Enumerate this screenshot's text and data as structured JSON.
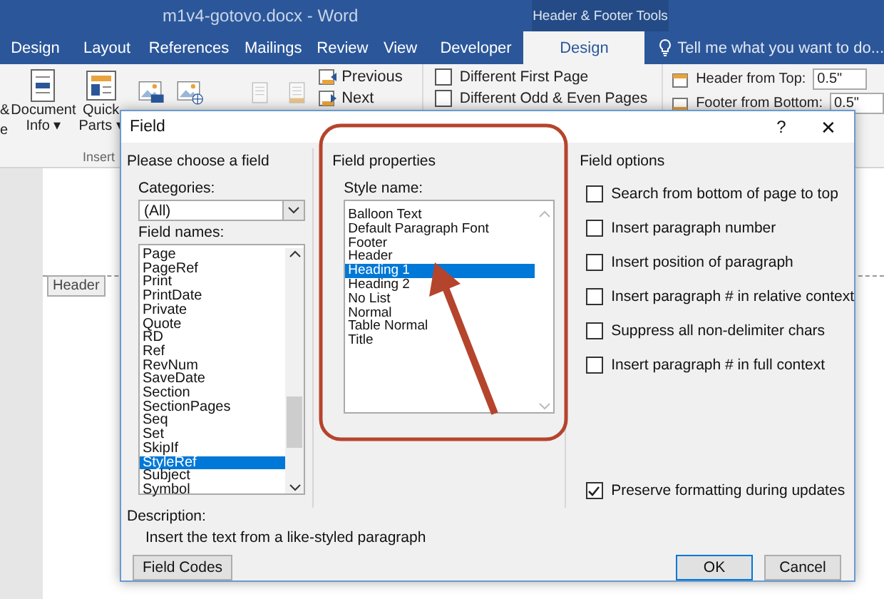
{
  "window": {
    "title": "m1v4-gotovo.docx - Word",
    "context_group": "Header & Footer Tools"
  },
  "ribbon_tabs": [
    {
      "label": "Design",
      "selected": false
    },
    {
      "label": "Layout",
      "selected": false
    },
    {
      "label": "References",
      "selected": false
    },
    {
      "label": "Mailings",
      "selected": false
    },
    {
      "label": "Review",
      "selected": false
    },
    {
      "label": "View",
      "selected": false
    },
    {
      "label": "Developer",
      "selected": false
    },
    {
      "label": "Design",
      "selected": true
    }
  ],
  "tell_me": {
    "placeholder": "Tell me what you want to do..."
  },
  "ribbon": {
    "left_fragments": [
      "&",
      "e"
    ],
    "insert_buttons": [
      {
        "label": "Document",
        "sub": "Info ▾"
      },
      {
        "label": "Quick",
        "sub": "Parts ▾"
      }
    ],
    "insert_group": "Insert",
    "navigation": [
      "Previous",
      "Next"
    ],
    "options": [
      {
        "label": "Different First Page",
        "checked": false
      },
      {
        "label": "Different Odd & Even Pages",
        "checked": false
      }
    ],
    "position": [
      {
        "label": "Header from Top:",
        "value": "0.5\""
      },
      {
        "label": "Footer from Bottom:",
        "value": "0.5\""
      }
    ]
  },
  "document": {
    "header_tag": "Header"
  },
  "dialog": {
    "title": "Field",
    "help": "?",
    "close": "✕",
    "choose": {
      "heading": "Please choose a field",
      "categories_label": "Categories:",
      "category": "(All)",
      "names_label": "Field names:",
      "names": [
        {
          "label": "Page",
          "selected": false
        },
        {
          "label": "PageRef",
          "selected": false
        },
        {
          "label": "Print",
          "selected": false
        },
        {
          "label": "PrintDate",
          "selected": false
        },
        {
          "label": "Private",
          "selected": false
        },
        {
          "label": "Quote",
          "selected": false
        },
        {
          "label": "RD",
          "selected": false
        },
        {
          "label": "Ref",
          "selected": false
        },
        {
          "label": "RevNum",
          "selected": false
        },
        {
          "label": "SaveDate",
          "selected": false
        },
        {
          "label": "Section",
          "selected": false
        },
        {
          "label": "SectionPages",
          "selected": false
        },
        {
          "label": "Seq",
          "selected": false
        },
        {
          "label": "Set",
          "selected": false
        },
        {
          "label": "SkipIf",
          "selected": false
        },
        {
          "label": "StyleRef",
          "selected": true
        },
        {
          "label": "Subject",
          "selected": false
        },
        {
          "label": "Symbol",
          "selected": false
        }
      ]
    },
    "properties": {
      "heading": "Field properties",
      "style_label": "Style name:",
      "styles": [
        {
          "label": "Balloon Text",
          "selected": false
        },
        {
          "label": "Default Paragraph Font",
          "selected": false
        },
        {
          "label": "Footer",
          "selected": false
        },
        {
          "label": "Header",
          "selected": false
        },
        {
          "label": "Heading 1",
          "selected": true
        },
        {
          "label": "Heading 2",
          "selected": false
        },
        {
          "label": "No List",
          "selected": false
        },
        {
          "label": "Normal",
          "selected": false
        },
        {
          "label": "Table Normal",
          "selected": false
        },
        {
          "label": "Title",
          "selected": false
        }
      ]
    },
    "options": {
      "heading": "Field options",
      "items": [
        {
          "label": "Search from bottom of page to top",
          "checked": false
        },
        {
          "label": "Insert paragraph number",
          "checked": false
        },
        {
          "label": "Insert position of paragraph",
          "checked": false
        },
        {
          "label": "Insert paragraph # in relative context",
          "checked": false
        },
        {
          "label": "Suppress all non-delimiter chars",
          "checked": false
        },
        {
          "label": "Insert paragraph # in full context",
          "checked": false
        }
      ],
      "preserve": {
        "label": "Preserve formatting during updates",
        "checked": true
      }
    },
    "description_label": "Description:",
    "description": "Insert the text from a like-styled paragraph",
    "buttons": [
      {
        "label": "Field Codes",
        "kind": "secondary"
      },
      {
        "label": "OK",
        "kind": "default"
      },
      {
        "label": "Cancel",
        "kind": "secondary"
      }
    ]
  }
}
